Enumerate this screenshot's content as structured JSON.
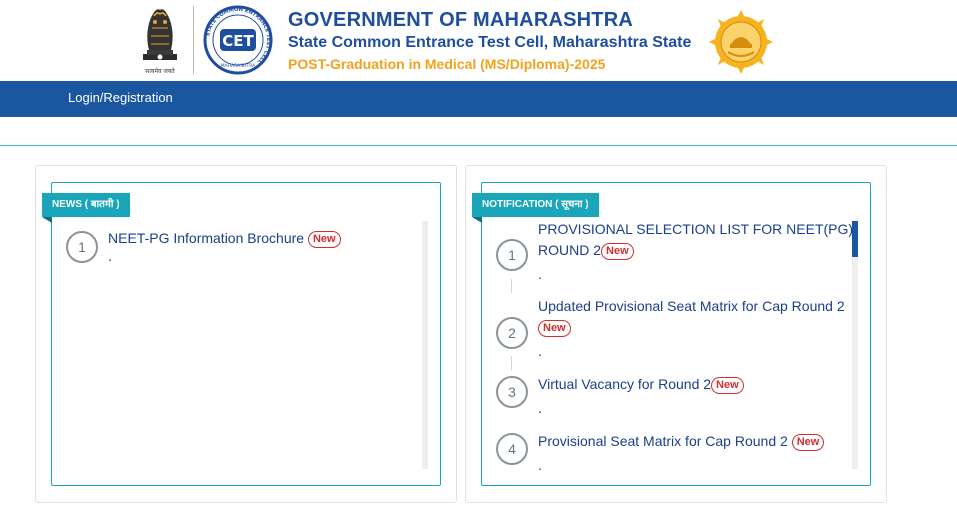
{
  "header": {
    "emblem_caption": "सत्यमेव जयते",
    "title": "GOVERNMENT OF MAHARASHTRA",
    "subtitle": "State Common Entrance Test Cell, Maharashtra State",
    "course": "POST-Graduation in Medical (MS/Diploma)-2025",
    "cet_logo_text": "CET",
    "cet_ring_text": "STATE COMMON ENTRANCE TEST CELL",
    "cet_ring_bottom": "MAHARASHTRA"
  },
  "nav": {
    "login": "Login/Registration"
  },
  "news": {
    "tag": "NEWS ( बातमी )",
    "items": [
      {
        "num": "1",
        "text": "NEET-PG Information Brochure",
        "badge": "New",
        "dot": "."
      }
    ]
  },
  "notification": {
    "tag": "NOTIFICATION ( सूचना )",
    "items": [
      {
        "num": "1",
        "text": "PROVISIONAL SELECTION LIST FOR NEET(PG) ROUND 2",
        "badge": "New",
        "dot": "."
      },
      {
        "num": "2",
        "text": "Updated Provisional Seat Matrix for Cap Round 2",
        "badge": "New",
        "dot": "."
      },
      {
        "num": "3",
        "text": "Virtual Vacancy for Round 2",
        "badge": "New",
        "dot": "."
      },
      {
        "num": "4",
        "text": "Provisional Seat Matrix for Cap Round 2",
        "badge": "New",
        "dot": "."
      }
    ]
  },
  "colors": {
    "nav": "#1a57a0",
    "accent": "#18a6b8",
    "title": "#1f4e9e",
    "course": "#f2a21c",
    "badge": "#d22f2f"
  },
  "icons": {
    "emblem": "national-emblem-icon",
    "cet": "cet-logo-icon",
    "seal": "maharashtra-seal-icon"
  }
}
